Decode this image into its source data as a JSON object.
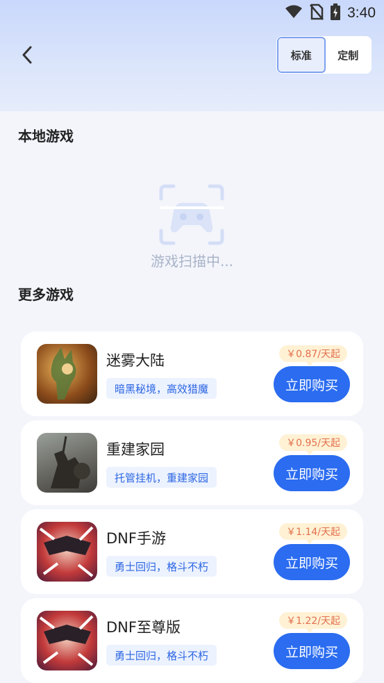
{
  "status_bar": {
    "time": "3:40",
    "icons": [
      "wifi-icon",
      "no-sim-icon",
      "battery-charging-icon"
    ]
  },
  "header": {
    "back_icon": "chevron-left-icon",
    "mode_options": [
      {
        "label": "标准",
        "active": true
      },
      {
        "label": "定制",
        "active": false
      }
    ]
  },
  "local_games": {
    "title": "本地游戏",
    "scan_icon": "gamepad-scan-icon",
    "scan_text": "游戏扫描中..."
  },
  "more_games": {
    "title": "更多游戏",
    "items": [
      {
        "name": "迷雾大陆",
        "tag": "暗黑秘境，高效猎魔",
        "price": "￥0.87/天起",
        "button": "立即购买"
      },
      {
        "name": "重建家园",
        "tag": "托管挂机，重建家园",
        "price": "￥0.95/天起",
        "button": "立即购买"
      },
      {
        "name": "DNF手游",
        "tag": "勇士回归，格斗不朽",
        "price": "￥1.14/天起",
        "button": "立即购买"
      },
      {
        "name": "DNF至尊版",
        "tag": "勇士回归，格斗不朽",
        "price": "￥1.22/天起",
        "button": "立即购买"
      }
    ]
  },
  "colors": {
    "accent": "#2b6cf0",
    "tag_bg": "#ecf2fe",
    "price_bg": "#fff1d4",
    "price_text": "#e2704e"
  }
}
